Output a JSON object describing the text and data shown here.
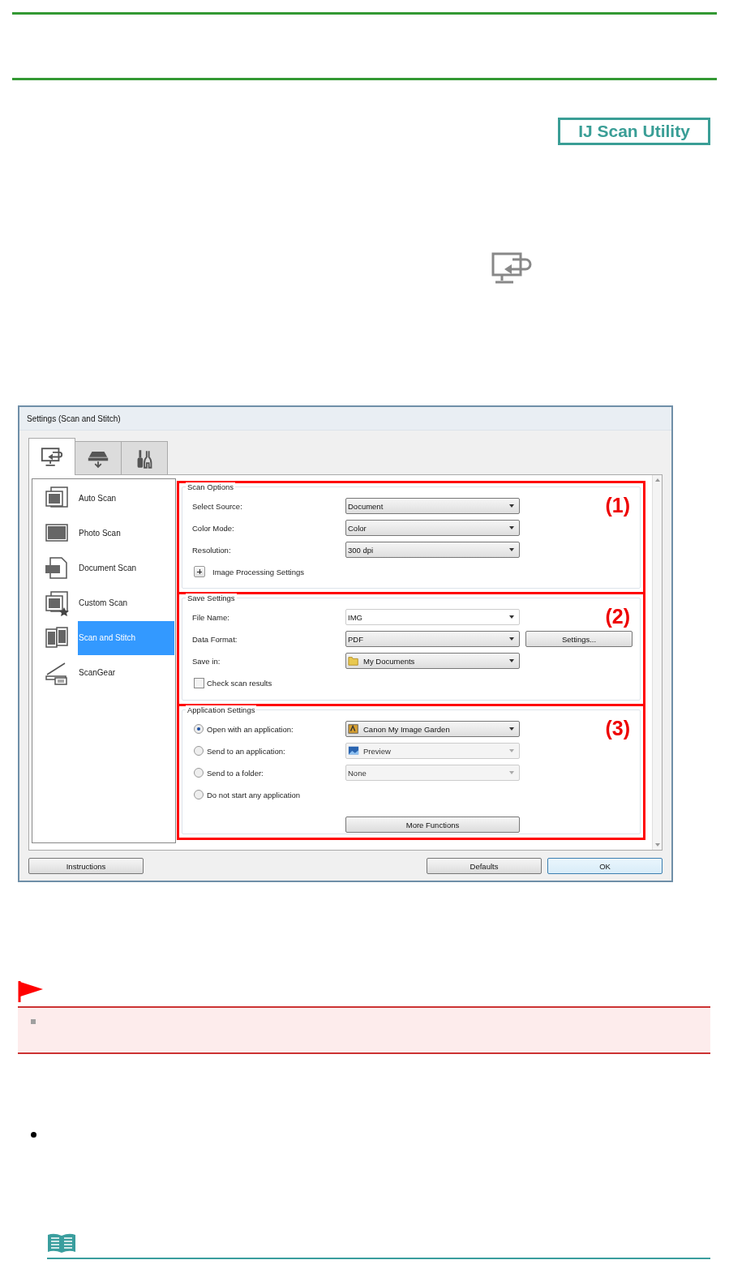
{
  "logo": {
    "text": "IJ Scan Utility"
  },
  "dialog": {
    "title": "Settings (Scan and Stitch)",
    "tabs": [
      {
        "kind": "computer",
        "selected": true
      },
      {
        "kind": "scanner",
        "selected": false
      },
      {
        "kind": "tools",
        "selected": false
      }
    ],
    "sidebar": {
      "items": [
        {
          "kind": "auto",
          "label": "Auto Scan",
          "selected": false
        },
        {
          "kind": "photo",
          "label": "Photo Scan",
          "selected": false
        },
        {
          "kind": "document",
          "label": "Document Scan",
          "selected": false
        },
        {
          "kind": "custom",
          "label": "Custom Scan",
          "selected": false
        },
        {
          "kind": "stitch",
          "label": "Scan and Stitch",
          "selected": true
        },
        {
          "kind": "scangear",
          "label": "ScanGear",
          "selected": false
        }
      ]
    },
    "groups": [
      {
        "title": "Scan Options",
        "marker": "(1)",
        "rows": [
          {
            "kind": "select",
            "label": "Select Source:",
            "value": "Document"
          },
          {
            "kind": "select",
            "label": "Color Mode:",
            "value": "Color"
          },
          {
            "kind": "select",
            "label": "Resolution:",
            "value": "300 dpi"
          },
          {
            "kind": "expander",
            "label": "Image Processing Settings",
            "expanded": false
          }
        ]
      },
      {
        "title": "Save Settings",
        "marker": "(2)",
        "rows": [
          {
            "kind": "combo",
            "label": "File Name:",
            "value": "IMG"
          },
          {
            "kind": "select",
            "label": "Data Format:",
            "value": "PDF",
            "button": "Settings..."
          },
          {
            "kind": "select",
            "label": "Save in:",
            "value": "My Documents"
          },
          {
            "kind": "checkbox",
            "label": "Check scan results",
            "checked": false
          }
        ]
      },
      {
        "title": "Application Settings",
        "marker": "(3)",
        "rows": [
          {
            "kind": "radio",
            "label": "Open with an application:",
            "selected": true,
            "value": "Canon My Image Garden",
            "disabled": false
          },
          {
            "kind": "radio",
            "label": "Send to an application:",
            "selected": false,
            "value": "Preview",
            "disabled": true
          },
          {
            "kind": "radio",
            "label": "Send to a folder:",
            "selected": false,
            "value": "None",
            "disabled": true
          },
          {
            "kind": "radio",
            "label": "Do not start any application",
            "selected": false
          },
          {
            "kind": "button",
            "label": "More Functions"
          }
        ]
      }
    ],
    "buttons": [
      {
        "label": "Instructions",
        "default": false
      },
      {
        "label": "Defaults",
        "default": false
      },
      {
        "label": "OK",
        "default": true
      }
    ]
  }
}
